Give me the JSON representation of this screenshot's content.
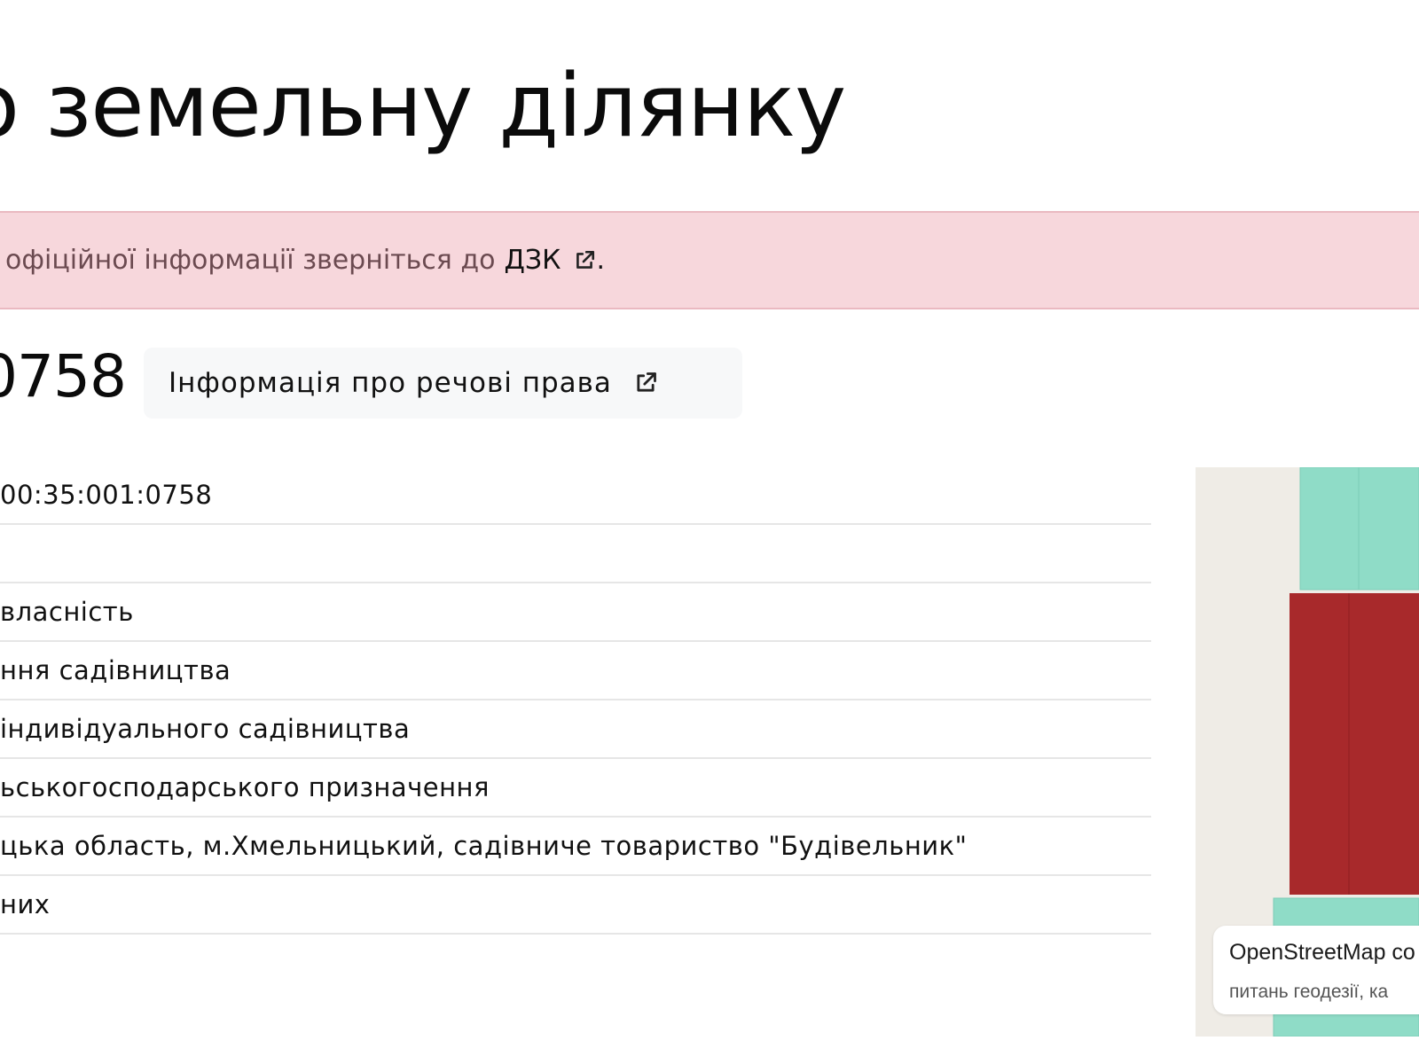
{
  "page": {
    "title": "о земельну ділянку"
  },
  "notice": {
    "text": "офіційної інформації зверніться до",
    "link_label": "ДЗК",
    "link_icon": "external-link-icon",
    "trailing": ".",
    "colors": {
      "background": "#f7d7dc",
      "text": "#6b4a50"
    }
  },
  "parcel": {
    "number_fragment": "0758",
    "rights_button_label": "Інформація про речові права",
    "rights_button_icon": "external-link-icon"
  },
  "info_rows": [
    "00:35:001:0758",
    "",
    " власність",
    "ння садівництва",
    "індивідуального садівництва",
    "ьськогосподарського призначення",
    "цька область, м.Хмельницький, садівниче товариство \"Будівельник\"",
    "них"
  ],
  "map": {
    "attribution_line1": "OpenStreetMap co",
    "attribution_line2": "питань геодезії, ка",
    "colors": {
      "background": "#efece6",
      "parcel_selected": "#a8292b",
      "parcel_neighbor": "#8fdcc7"
    }
  }
}
